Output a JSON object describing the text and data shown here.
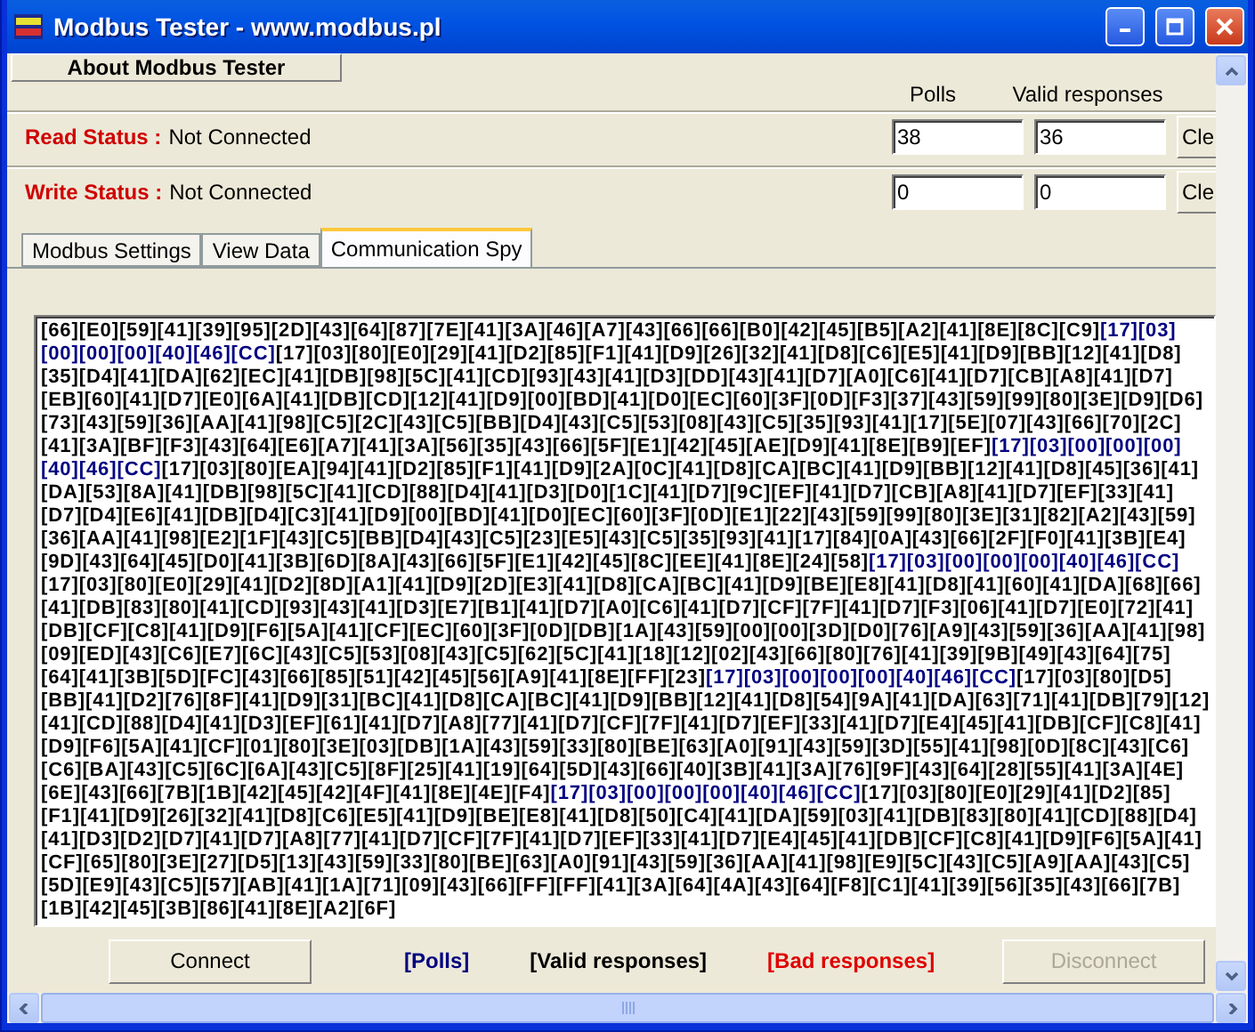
{
  "window": {
    "title": "Modbus Tester - www.modbus.pl"
  },
  "about_button": "About Modbus Tester",
  "counter_headers": [
    "Polls",
    "Valid responses"
  ],
  "status_rows": [
    {
      "label": "Read Status :",
      "value": "Not Connected",
      "polls": "38",
      "valid": "36",
      "clear_button": "Cle"
    },
    {
      "label": "Write Status :",
      "value": "Not Connected",
      "polls": "0",
      "valid": "0",
      "clear_button": "Cle"
    }
  ],
  "tabs": [
    {
      "label": "Modbus Settings",
      "selected": false
    },
    {
      "label": "View Data",
      "selected": false
    },
    {
      "label": "Communication Spy",
      "selected": true
    }
  ],
  "log": [
    [
      {
        "text": "[66][E0][59][41][39][95][2D][43][64][87][7E][41][3A][46][A7][43][66][66][B0][42][45][B5][A2][41][8E][8C][C9]",
        "kind": "valid"
      },
      {
        "text": "[17][03]",
        "kind": "poll"
      }
    ],
    [
      {
        "text": "[00][00][00][40][46][CC]",
        "kind": "poll"
      },
      {
        "text": "[17][03][80][E0][29][41][D2][85][F1][41][D9][26][32][41][D8][C6][E5][41][D9][BB][12][41][D8]",
        "kind": "valid"
      }
    ],
    [
      {
        "text": "[35][D4][41][DA][62][EC][41][DB][98][5C][41][CD][93][43][41][D3][DD][43][41][D7][A0][C6][41][D7][CB][A8][41][D7]",
        "kind": "valid"
      }
    ],
    [
      {
        "text": "[EB][60][41][D7][E0][6A][41][DB][CD][12][41][D9][00][BD][41][D0][EC][60][3F][0D][F3][37][43][59][99][80][3E][D9][D6]",
        "kind": "valid"
      }
    ],
    [
      {
        "text": "[73][43][59][36][AA][41][98][C5][2C][43][C5][BB][D4][43][C5][53][08][43][C5][35][93][41][17][5E][07][43][66][70][2C]",
        "kind": "valid"
      }
    ],
    [
      {
        "text": "[41][3A][BF][F3][43][64][E6][A7][41][3A][56][35][43][66][5F][E1][42][45][AE][D9][41][8E][B9][EF]",
        "kind": "valid"
      },
      {
        "text": "[17][03][00][00][00]",
        "kind": "poll"
      }
    ],
    [
      {
        "text": "[40][46][CC]",
        "kind": "poll"
      },
      {
        "text": "[17][03][80][EA][94][41][D2][85][F1][41][D9][2A][0C][41][D8][CA][BC][41][D9][BB][12][41][D8][45][36][41]",
        "kind": "valid"
      }
    ],
    [
      {
        "text": "[DA][53][8A][41][DB][98][5C][41][CD][88][D4][41][D3][D0][1C][41][D7][9C][EF][41][D7][CB][A8][41][D7][EF][33][41]",
        "kind": "valid"
      }
    ],
    [
      {
        "text": "[D7][D4][E6][41][DB][D4][C3][41][D9][00][BD][41][D0][EC][60][3F][0D][E1][22][43][59][99][80][3E][31][82][A2][43][59]",
        "kind": "valid"
      }
    ],
    [
      {
        "text": "[36][AA][41][98][E2][1F][43][C5][BB][D4][43][C5][23][E5][43][C5][35][93][41][17][84][0A][43][66][2F][F0][41][3B][E4]",
        "kind": "valid"
      }
    ],
    [
      {
        "text": "[9D][43][64][45][D0][41][3B][6D][8A][43][66][5F][E1][42][45][8C][EE][41][8E][24][58]",
        "kind": "valid"
      },
      {
        "text": "[17][03][00][00][00][40][46][CC]",
        "kind": "poll"
      }
    ],
    [
      {
        "text": "[17][03][80][E0][29][41][D2][8D][A1][41][D9][2D][E3][41][D8][CA][BC][41][D9][BE][E8][41][D8][41][60][41][DA][68][66]",
        "kind": "valid"
      }
    ],
    [
      {
        "text": "[41][DB][83][80][41][CD][93][43][41][D3][E7][B1][41][D7][A0][C6][41][D7][CF][7F][41][D7][F3][06][41][D7][E0][72][41]",
        "kind": "valid"
      }
    ],
    [
      {
        "text": "[DB][CF][C8][41][D9][F6][5A][41][CF][EC][60][3F][0D][DB][1A][43][59][00][00][3D][D0][76][A9][43][59][36][AA][41][98]",
        "kind": "valid"
      }
    ],
    [
      {
        "text": "[09][ED][43][C6][E7][6C][43][C5][53][08][43][C5][62][5C][41][18][12][02][43][66][80][76][41][39][9B][49][43][64][75]",
        "kind": "valid"
      }
    ],
    [
      {
        "text": "[64][41][3B][5D][FC][43][66][85][51][42][45][56][A9][41][8E][FF][23]",
        "kind": "valid"
      },
      {
        "text": "[17][03][00][00][00][40][46][CC]",
        "kind": "poll"
      },
      {
        "text": "[17][03][80][D5]",
        "kind": "valid"
      }
    ],
    [
      {
        "text": "[BB][41][D2][76][8F][41][D9][31][BC][41][D8][CA][BC][41][D9][BB][12][41][D8][54][9A][41][DA][63][71][41][DB][79][12]",
        "kind": "valid"
      }
    ],
    [
      {
        "text": "[41][CD][88][D4][41][D3][EF][61][41][D7][A8][77][41][D7][CF][7F][41][D7][EF][33][41][D7][E4][45][41][DB][CF][C8][41]",
        "kind": "valid"
      }
    ],
    [
      {
        "text": "[D9][F6][5A][41][CF][01][80][3E][03][DB][1A][43][59][33][80][BE][63][A0][91][43][59][3D][55][41][98][0D][8C][43][C6]",
        "kind": "valid"
      }
    ],
    [
      {
        "text": "[C6][BA][43][C5][6C][6A][43][C5][8F][25][41][19][64][5D][43][66][40][3B][41][3A][76][9F][43][64][28][55][41][3A][4E]",
        "kind": "valid"
      }
    ],
    [
      {
        "text": "[6E][43][66][7B][1B][42][45][42][4F][41][8E][4E][F4]",
        "kind": "valid"
      },
      {
        "text": "[17][03][00][00][00][40][46][CC]",
        "kind": "poll"
      },
      {
        "text": "[17][03][80][E0][29][41][D2][85]",
        "kind": "valid"
      }
    ],
    [
      {
        "text": "[F1][41][D9][26][32][41][D8][C6][E5][41][D9][BE][E8][41][D8][50][C4][41][DA][59][03][41][DB][83][80][41][CD][88][D4]",
        "kind": "valid"
      }
    ],
    [
      {
        "text": "[41][D3][D2][D7][41][D7][A8][77][41][D7][CF][7F][41][D7][EF][33][41][D7][E4][45][41][DB][CF][C8][41][D9][F6][5A][41]",
        "kind": "valid"
      }
    ],
    [
      {
        "text": "[CF][65][80][3E][27][D5][13][43][59][33][80][BE][63][A0][91][43][59][36][AA][41][98][E9][5C][43][C5][A9][AA][43][C5]",
        "kind": "valid"
      }
    ],
    [
      {
        "text": "[5D][E9][43][C5][57][AB][41][1A][71][09][43][66][FF][FF][41][3A][64][4A][43][64][F8][C1][41][39][56][35][43][66][7B]",
        "kind": "valid"
      }
    ],
    [
      {
        "text": "[1B][42][45][3B][86][41][8E][A2][6F]",
        "kind": "valid"
      }
    ]
  ],
  "connect_button": {
    "label": "Connect",
    "disabled": false
  },
  "legend": [
    {
      "text": "[Polls]",
      "kind": "poll"
    },
    {
      "text": "[Valid responses]",
      "kind": "valid"
    },
    {
      "text": "[Bad responses]",
      "kind": "bad"
    }
  ],
  "disconnect_button": {
    "label": "Disconnect",
    "disabled": true
  }
}
